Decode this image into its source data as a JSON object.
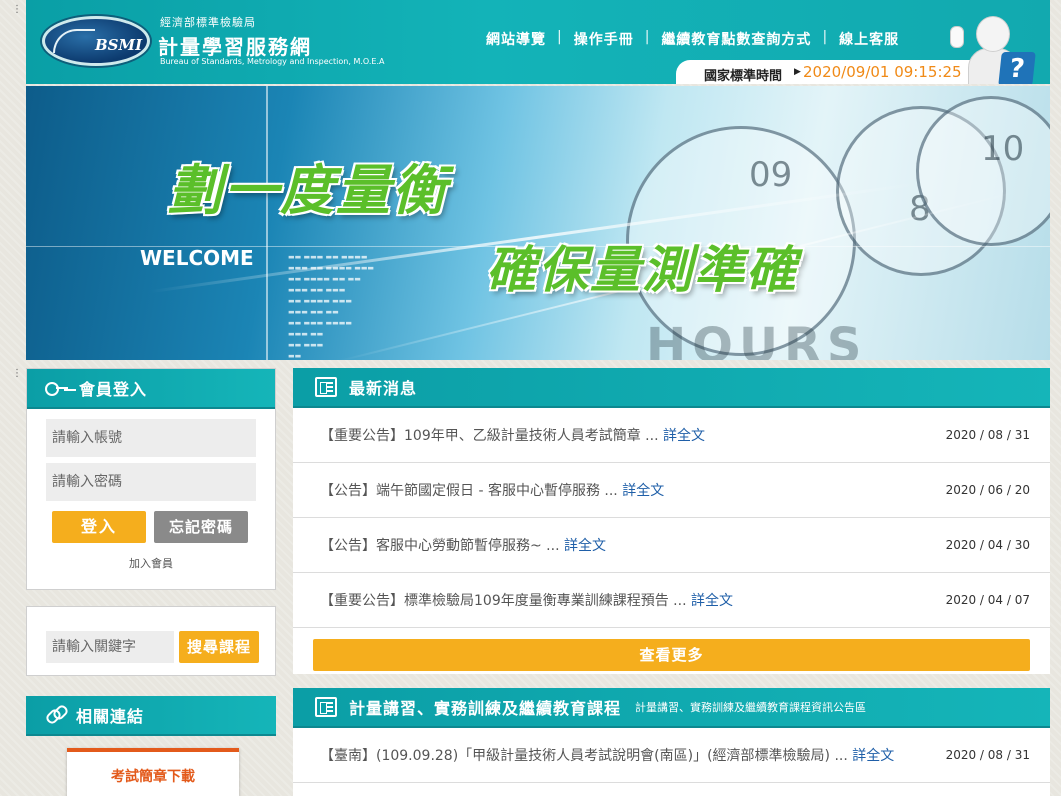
{
  "header": {
    "logo_text": "BSMI",
    "agency_name": "經濟部標準檢驗局",
    "site_title": "計量學習服務網",
    "site_subtitle": "Bureau of Standards, Metrology and Inspection, M.O.E.A",
    "nav": [
      "網站導覽",
      "操作手冊",
      "繼續教育點數查詢方式",
      "線上客服"
    ],
    "time_label": "國家標準時間",
    "time_value": "2020/09/01 09:15:25",
    "help_glyph": "?"
  },
  "banner": {
    "headline1": "劃一度量衡",
    "headline2": "確保量測準確",
    "welcome": "WELCOME",
    "hours": "HOURS",
    "clock1_num": "09",
    "clock2_num": "8",
    "clock3_num": "10"
  },
  "login": {
    "title": "會員登入",
    "account_placeholder": "請輸入帳號",
    "password_placeholder": "請輸入密碼",
    "login_button": "登入",
    "forgot_button": "忘記密碼",
    "join_link": "加入會員"
  },
  "search": {
    "keyword_placeholder": "請輸入關鍵字",
    "button": "搜尋課程"
  },
  "links": {
    "title": "相關連結",
    "exam_card": "考試簡章下載"
  },
  "news": {
    "title": "最新消息",
    "items": [
      {
        "title": "【重要公告】109年甲、乙級計量技術人員考試簡章 ...",
        "more": "詳全文",
        "date": "2020 / 08 / 31"
      },
      {
        "title": "【公告】端午節國定假日 - 客服中心暫停服務 ...",
        "more": "詳全文",
        "date": "2020 / 06 / 20"
      },
      {
        "title": "【公告】客服中心勞動節暫停服務~ ...",
        "more": "詳全文",
        "date": "2020 / 04 / 30"
      },
      {
        "title": "【重要公告】標準檢驗局109年度量衡專業訓練課程預告 ...",
        "more": "詳全文",
        "date": "2020 / 04 / 07"
      }
    ],
    "more_button": "查看更多"
  },
  "courses": {
    "title": "計量講習、實務訓練及繼續教育課程",
    "subtitle": "計量講習、實務訓練及繼續教育課程資訊公告區",
    "items": [
      {
        "title": "【臺南】(109.09.28)「甲級計量技術人員考試說明會(南區)」(經濟部標準檢驗局) ...",
        "more": "詳全文",
        "date": "2020 / 08 / 31"
      }
    ]
  }
}
